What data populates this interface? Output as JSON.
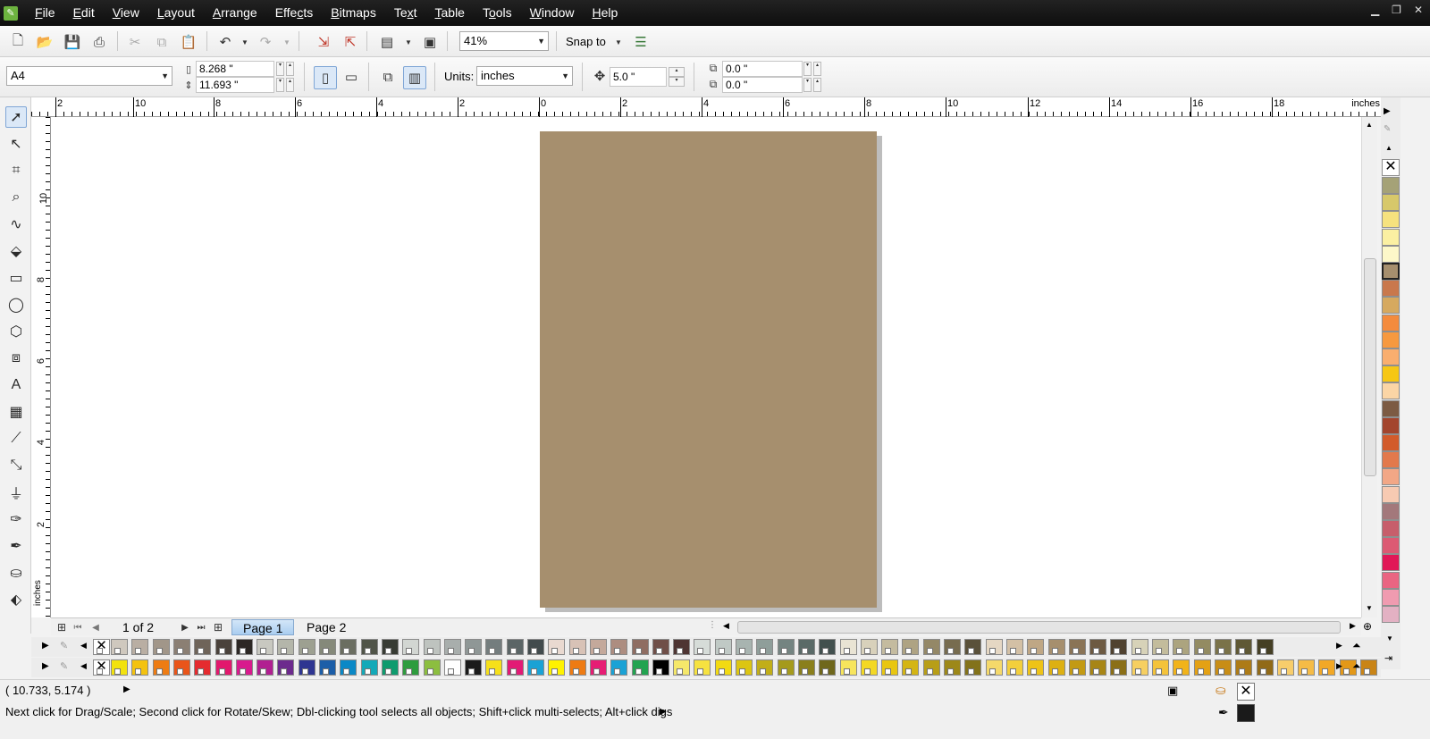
{
  "menu": {
    "items": [
      {
        "key": "F",
        "rest": "ile"
      },
      {
        "key": "E",
        "rest": "dit"
      },
      {
        "key": "V",
        "rest": "iew"
      },
      {
        "key": "L",
        "rest": "ayout"
      },
      {
        "key": "A",
        "rest": "rrange"
      },
      {
        "pre": "Effe",
        "key": "c",
        "rest": "ts"
      },
      {
        "key": "B",
        "rest": "itmaps"
      },
      {
        "pre": "Te",
        "key": "x",
        "rest": "t"
      },
      {
        "key": "T",
        "rest": "able"
      },
      {
        "pre": "T",
        "key": "o",
        "rest": "ols"
      },
      {
        "key": "W",
        "rest": "indow"
      },
      {
        "key": "H",
        "rest": "elp"
      }
    ]
  },
  "toolbar": {
    "zoom": "41%",
    "snap_label": "Snap to"
  },
  "property_bar": {
    "paper_size": "A4",
    "width": "8.268 \"",
    "height": "11.693 \"",
    "units_label": "Units:",
    "units_value": "inches",
    "nudge": "5.0 \"",
    "dup_x": "0.0 \"",
    "dup_y": "0.0 \""
  },
  "rulers": {
    "unit": "inches",
    "h_ticks": [
      "2",
      "10",
      "8",
      "6",
      "4",
      "2",
      "0",
      "2",
      "4",
      "6",
      "8",
      "10",
      "12",
      "14",
      "16",
      "18"
    ],
    "v_ticks": [
      "10",
      "8",
      "6",
      "4",
      "2"
    ],
    "v_unit": "inches"
  },
  "document": {
    "page_color": "#a68f6e"
  },
  "page_nav": {
    "counter": "1 of 2",
    "tabs": [
      "Page 1",
      "Page 2"
    ]
  },
  "palettes": {
    "right": [
      "#a5a277",
      "#d7c86a",
      "#f6e27e",
      "#fbf0a2",
      "#fdf8c9",
      "#a68f6e",
      "#c9784c",
      "#d6a95f",
      "#f48b3d",
      "#f7993f",
      "#f9ae6e",
      "#f6c714",
      "#fbd5a5",
      "#7c5b43",
      "#a3452d",
      "#d25b2b",
      "#e2794c",
      "#f2a786",
      "#f7cab2",
      "#a3787b",
      "#c75e6b",
      "#dc5a73",
      "#e11857",
      "#ea6582",
      "#f09bb0",
      "#e3b1c3"
    ],
    "grey_row": [
      "#cfc8be",
      "#b9aea3",
      "#a19689",
      "#8b7f73",
      "#6f6459",
      "#4a423b",
      "#2c2724",
      "#c8c8c0",
      "#b4b6aa",
      "#9da091",
      "#85897a",
      "#6b6e61",
      "#505448",
      "#383c34",
      "#d2d6d2",
      "#bec3bf",
      "#a8aeac",
      "#8f9796",
      "#747d7e",
      "#5b6566",
      "#424b4d",
      "#e9d9d0",
      "#d8c2b6",
      "#c4a99b",
      "#ad8d80",
      "#8f6d62",
      "#6f4f48",
      "#4e3533",
      "#d6dcd8",
      "#c0c9c5",
      "#a8b4b0",
      "#8f9e9a",
      "#748481",
      "#5a6a67",
      "#42504e",
      "#e9e4d4",
      "#d8d1bb",
      "#c4bb9f",
      "#aea383",
      "#948867",
      "#776c4f",
      "#5a513a",
      "#e5d7c3",
      "#d3c0a5",
      "#bfa785",
      "#a68f6e",
      "#8a7456",
      "#6d5a42",
      "#504230",
      "#d7d2b8",
      "#c3bc9c",
      "#aca47f",
      "#938b62",
      "#7a7249",
      "#5f5835",
      "#453f24"
    ],
    "color_row": [
      "#f2e20e",
      "#f3c20f",
      "#ee7c13",
      "#e9551a",
      "#e52b2f",
      "#e2186d",
      "#d81a8d",
      "#b11f91",
      "#6c2a8d",
      "#2e3591",
      "#1c5ea8",
      "#0a88c6",
      "#13a9b8",
      "#0e9b6e",
      "#2e9c3e",
      "#8cbe3f",
      "#ffffff",
      "#1a1a1a",
      "#f6e01a",
      "#e21a75",
      "#1aa2d5",
      "#fff200",
      "#ee7b13",
      "#e61d74",
      "#1aa2d5",
      "#22a350",
      "#000000",
      "#f5e86a",
      "#f6e240",
      "#f2da12",
      "#dcc512",
      "#c1ae18",
      "#a59a1c",
      "#8a7f1c",
      "#6f671c",
      "#f7e55c",
      "#f3d824",
      "#e8c611",
      "#d4b514",
      "#b89e17",
      "#9d8818",
      "#83721a",
      "#f5d96a",
      "#f3cf3c",
      "#eec317",
      "#ddb012",
      "#c39a14",
      "#a78516",
      "#8b6f17",
      "#f6cf60",
      "#f4c33a",
      "#f1b31a",
      "#e4a114",
      "#c88d16",
      "#ad7b17",
      "#916a18",
      "#f8cd6b",
      "#f5bb46",
      "#f2a826",
      "#e39818",
      "#c98416"
    ]
  },
  "status": {
    "coords": "( 10.733, 5.174 )",
    "hint": "Next click for Drag/Scale; Second click for Rotate/Skew; Dbl-clicking tool selects all objects; Shift+click multi-selects; Alt+click digs",
    "fill_color": "none",
    "outline_color": "#1a1a1a"
  }
}
